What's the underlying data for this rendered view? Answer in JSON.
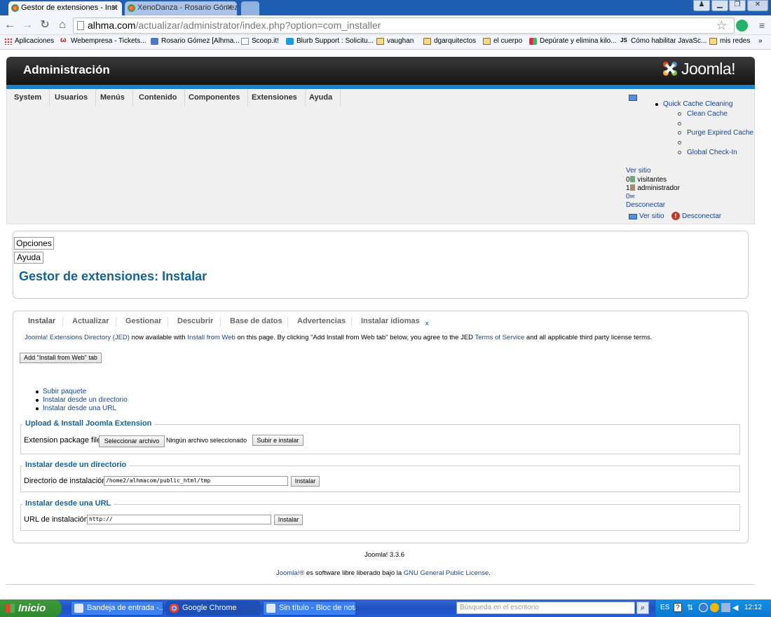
{
  "browser": {
    "tabs": [
      {
        "label": "Gestor de extensiones - Inst",
        "active": true
      },
      {
        "label": "XenoDanza - Rosario Gómez",
        "active": false
      }
    ],
    "url_host": "alhma.com",
    "url_path": "/actualizar/administrator/index.php?option=com_installer",
    "bookmarks": [
      "Aplicaciones",
      "Webempresa - Tickets...",
      "Rosario Gómez [Alhma...",
      "Scoop.it!",
      "Blurb Support : Solicitu...",
      "vaughan",
      "dgarquitectos",
      "el cuerpo",
      "Depúrate y elimina kilo...",
      "Cómo habilitar JavaSc...",
      "mis redes"
    ]
  },
  "admin": {
    "title": "Administración",
    "logo": "Joomla!",
    "menu": [
      "System",
      "Usuarios",
      "Menús",
      "Contenido",
      "Componentes",
      "Extensiones",
      "Ayuda"
    ],
    "quick_cache": "Quick Cache Cleaning",
    "quick_cache_items": [
      "Clean Cache",
      "Purge Expired Cache",
      "Global Check-In"
    ],
    "ver_sitio": "Ver sitio",
    "visitors": "visitantes",
    "visitors_count": "0",
    "admins": "administrador",
    "admins_count": "1",
    "msgs_count": "0",
    "logout": "Desconectar"
  },
  "toolbar": {
    "options": "Opciones",
    "help": "Ayuda"
  },
  "page_title": "Gestor de extensiones: Instalar",
  "subtabs": [
    "Instalar",
    "Actualizar",
    "Gestionar",
    "Descubrir",
    "Base de datos",
    "Advertencias",
    "Instalar idiomas"
  ],
  "jed": {
    "link1": "Joomla! Extensions Directory (JED)",
    "t1": " now available with ",
    "link2": "Install from Web",
    "t2": " on this page.  By clicking \"Add Install from Web tab\" below, you agree to the JED ",
    "link3": "Terms of Service",
    "t3": " and all applicable third party license terms.",
    "button": "Add \"Install from Web\" tab"
  },
  "methods": [
    "Subir paquete",
    "Instalar desde un directorio",
    "Instalar desde una URL"
  ],
  "upload": {
    "legend": "Upload & Install Joomla Extension",
    "label": "Extension package file",
    "choose": "Seleccionar archivo",
    "none": "Ningún archivo seleccionado",
    "submit": "Subir e instalar"
  },
  "dir": {
    "legend": "Instalar desde un directorio",
    "label": "Directorio de instalación",
    "value": "/home2/alhmacom/public_html/tmp",
    "submit": "Instalar"
  },
  "url": {
    "legend": "Instalar desde una URL",
    "label": "URL de instalación",
    "value": "http://",
    "submit": "Instalar"
  },
  "footer": {
    "version": "Joomla! 3.3.6",
    "link": "Joomla!®",
    "text": " es software libre liberado bajo la ",
    "license": "GNU General Public License",
    "end": "."
  },
  "taskbar": {
    "start": "Inicio",
    "tasks": [
      "Bandeja de entrada -...",
      "Google Chrome",
      "Sin título - Bloc de notas"
    ],
    "search": "Búsqueda en el escritorio",
    "lang": "ES",
    "clock": "12:12"
  },
  "colors": {
    "joomla_blue": "#146295",
    "link": "#15458f",
    "header_bar": "#1a82c4"
  }
}
